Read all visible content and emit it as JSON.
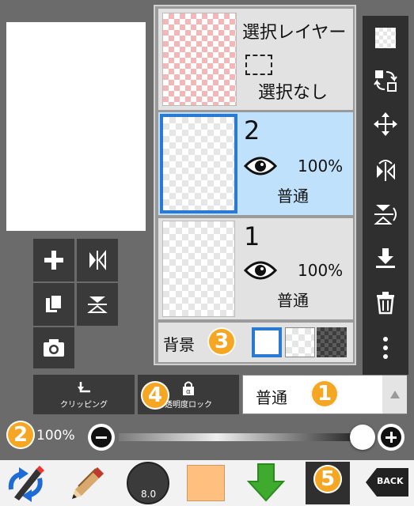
{
  "layers_panel": {
    "selection_layer": {
      "name": "選択レイヤー",
      "status": "選択なし"
    },
    "layers": [
      {
        "number": "2",
        "opacity": "100%",
        "blend": "普通",
        "selected": true
      },
      {
        "number": "1",
        "opacity": "100%",
        "blend": "普通",
        "selected": false
      }
    ],
    "background": {
      "label": "背景"
    }
  },
  "controls": {
    "clipping_label": "クリッピング",
    "alpha_lock_label": "透明度ロック",
    "blend_mode_value": "普通",
    "opacity_value": "100%"
  },
  "bottom_bar": {
    "brush_size": "8.0",
    "back_label": "BACK",
    "color_hex": "#FFBF7F"
  },
  "annotations": {
    "n1": "1",
    "n2": "2",
    "n3": "3",
    "n4": "4",
    "n5": "5"
  },
  "colors": {
    "selected_layer_bg": "#bfe1fb",
    "selected_border": "#2a7ad4",
    "annotation_orange": "#f5a623",
    "toolbar_dark": "#3a3a3a"
  }
}
